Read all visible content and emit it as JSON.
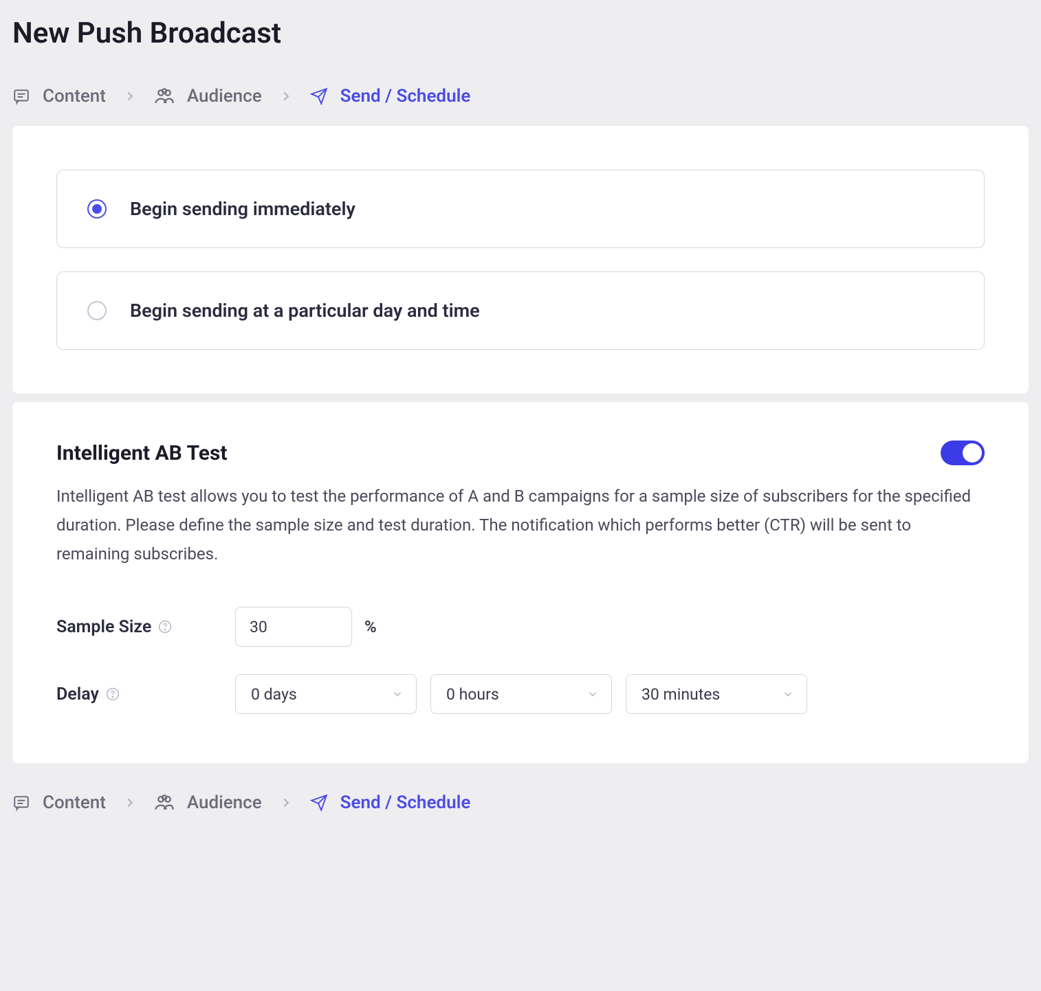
{
  "pageTitle": "New Push Broadcast",
  "breadcrumb": {
    "content": "Content",
    "audience": "Audience",
    "sendSchedule": "Send / Schedule"
  },
  "schedule": {
    "option1": "Begin sending immediately",
    "option2": "Begin sending at a particular day and time"
  },
  "abTest": {
    "title": "Intelligent AB Test",
    "description": "Intelligent AB test allows you to test the performance of A and B campaigns for a sample size of subscribers for the specified duration. Please define the sample size and test duration. The notification which performs better (CTR) will be sent to remaining subscribes.",
    "sampleSizeLabel": "Sample Size",
    "sampleSizeValue": "30",
    "percentSymbol": "%",
    "delayLabel": "Delay",
    "delayDays": "0 days",
    "delayHours": "0 hours",
    "delayMinutes": "30 minutes"
  }
}
